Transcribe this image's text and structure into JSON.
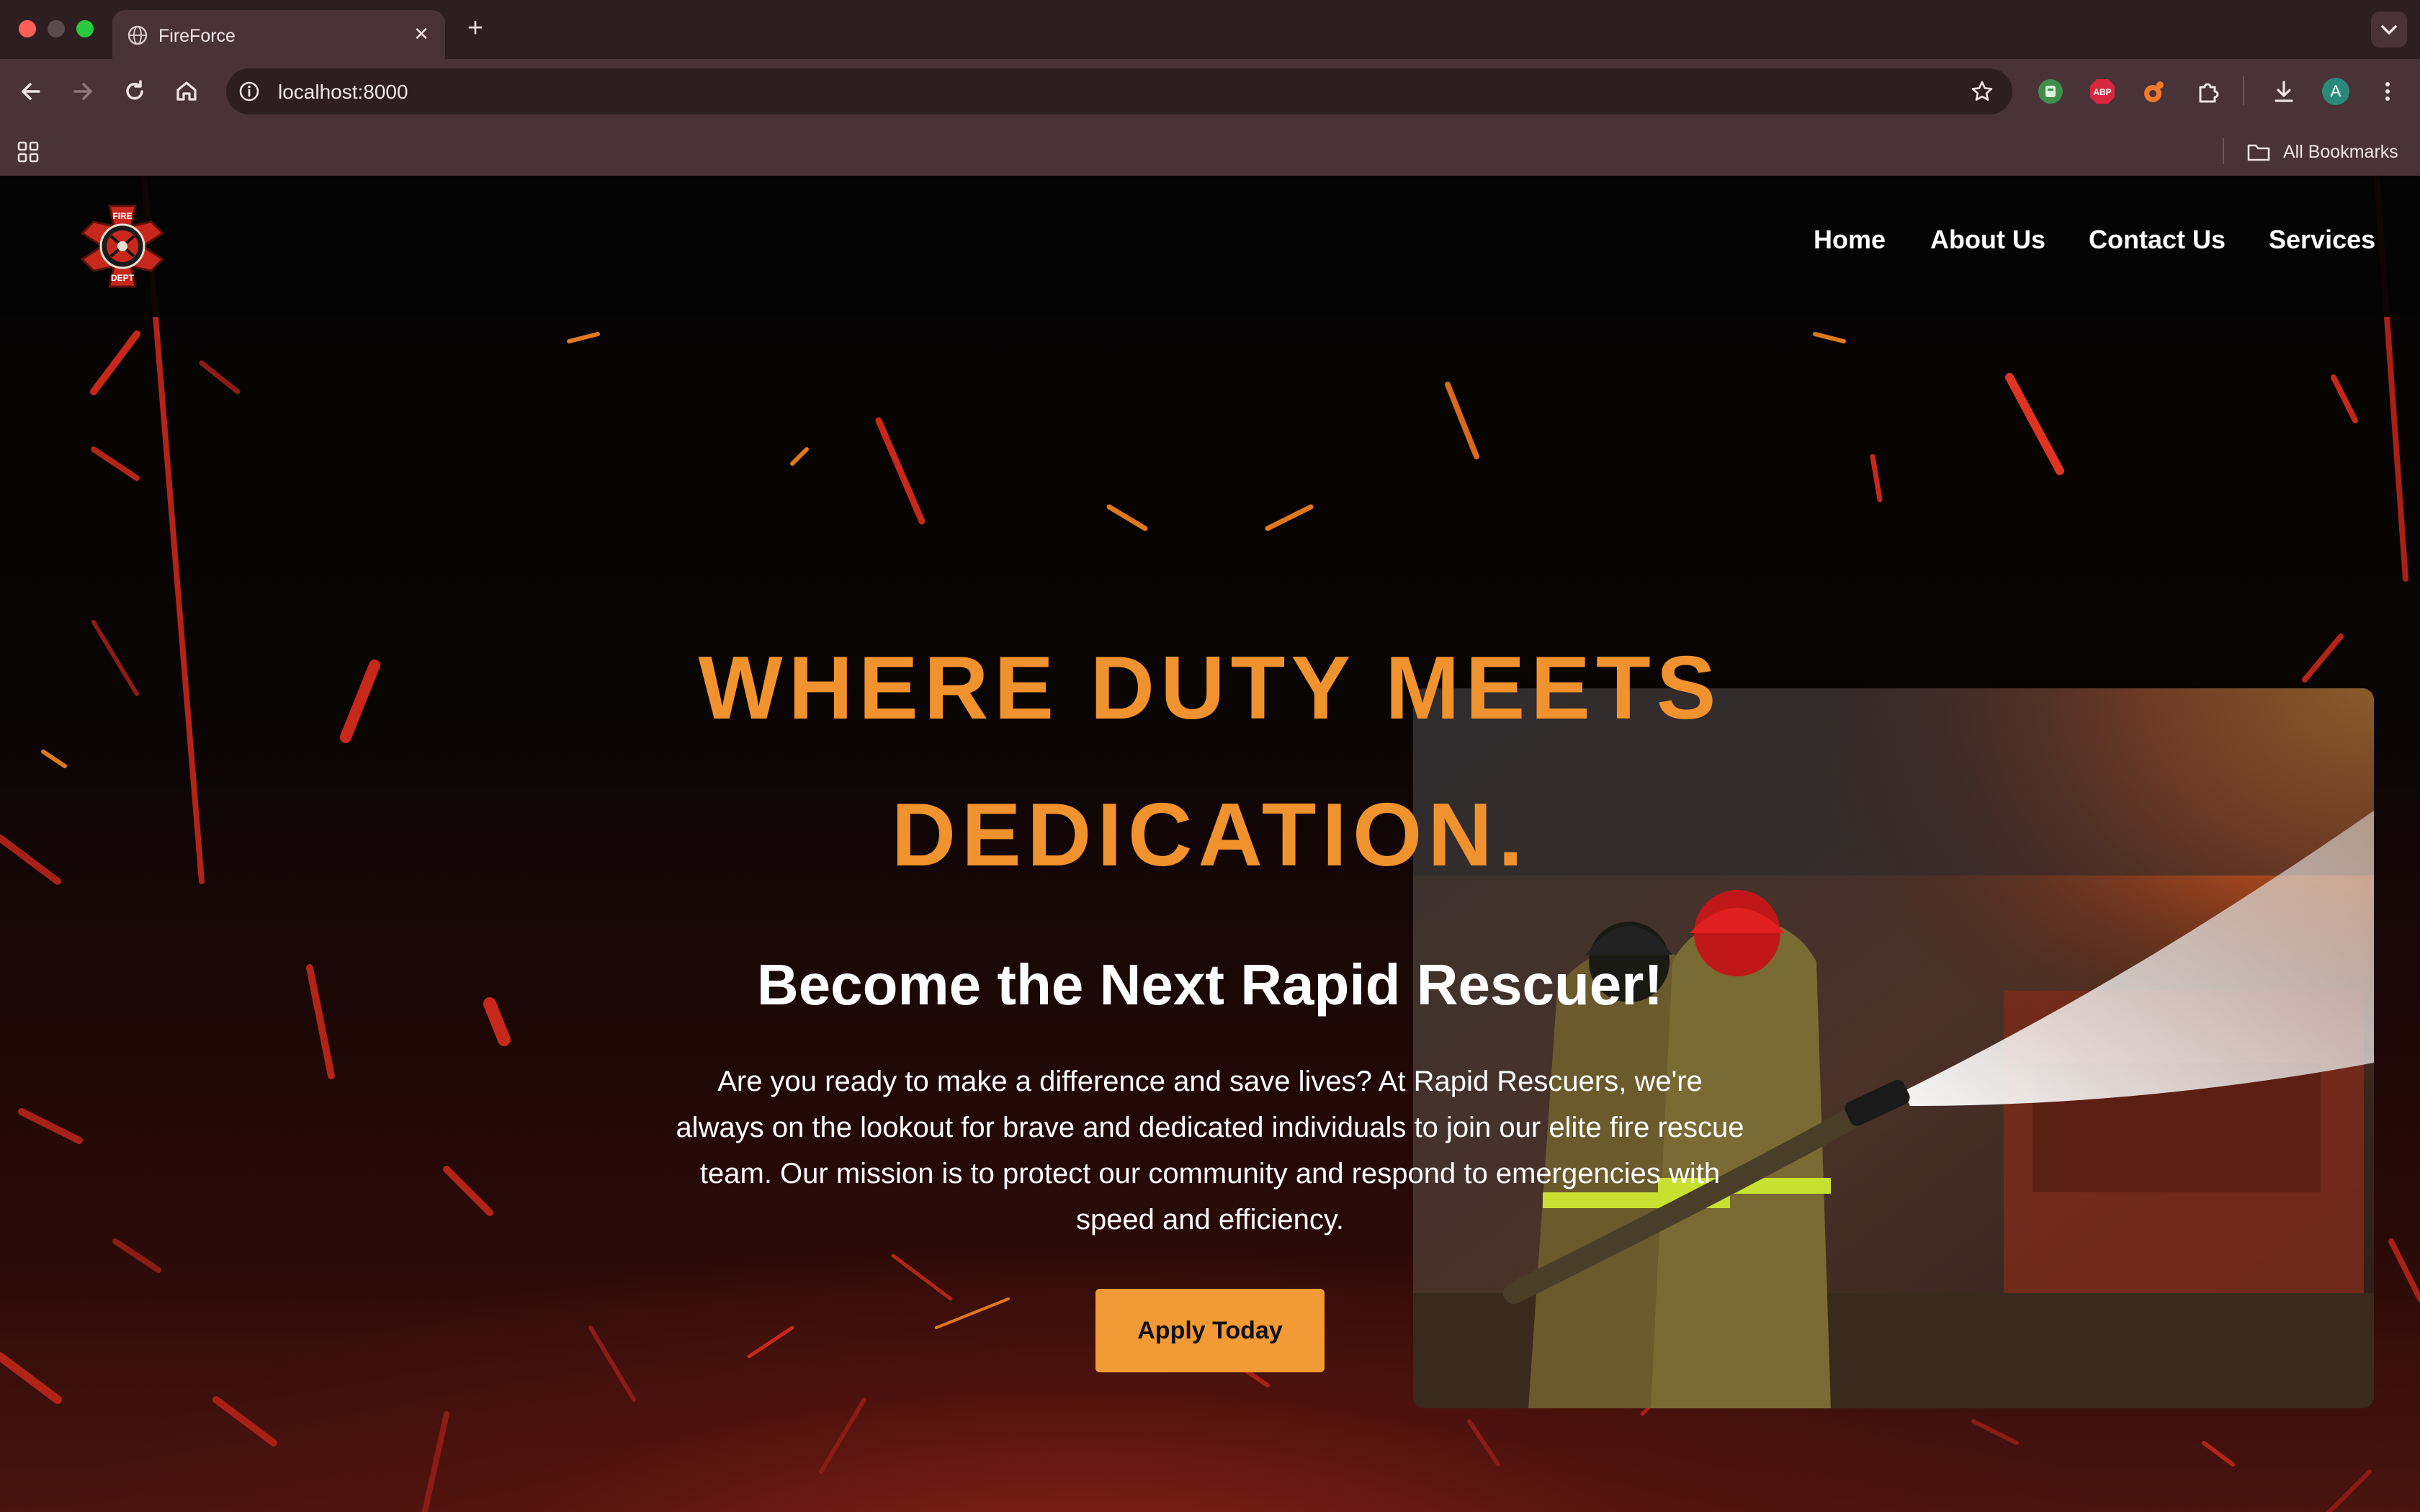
{
  "browser": {
    "tab_title": "FireForce",
    "url": "localhost:8000",
    "bookmarks_label": "All Bookmarks",
    "profile_initial": "A",
    "extension_abp": "ABP"
  },
  "site": {
    "logo_text_top": "FIRE",
    "logo_text_bottom": "DEPT",
    "nav": [
      "Home",
      "About Us",
      "Contact Us",
      "Services"
    ]
  },
  "hero": {
    "headline_line1": "WHERE DUTY MEETS",
    "headline_line2": "DEDICATION.",
    "subheading": "Become the Next Rapid Rescuer!",
    "paragraph": "Are you ready to make a difference and save lives? At Rapid Rescuers, we're always on the lookout for brave and dedicated individuals to join our elite fire rescue team. Our mission is to protect our community and respond to emergencies with speed and efficiency.",
    "cta": "Apply Today"
  },
  "colors": {
    "accent": "#f0922e",
    "button": "#f29a36",
    "chrome": "#4a3338"
  }
}
